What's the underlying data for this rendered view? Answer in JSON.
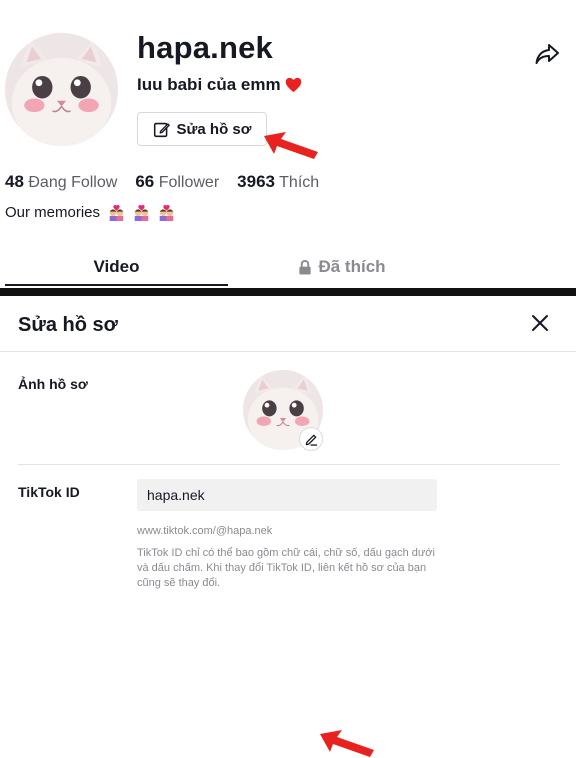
{
  "profile": {
    "username": "hapa.nek",
    "bio": "Iuu babi của emm",
    "bio_emoji": "heart",
    "edit_button_label": "Sửa hồ sơ",
    "stats": [
      {
        "value": "48",
        "label": "Đang Follow"
      },
      {
        "value": "66",
        "label": "Follower"
      },
      {
        "value": "3963",
        "label": "Thích"
      }
    ],
    "memories_text": "Our memories",
    "memories_emoji": [
      "couple-kiss",
      "couple-kiss",
      "couple-kiss"
    ],
    "tabs": [
      {
        "label": "Video",
        "active": true
      },
      {
        "label": "Đã thích",
        "locked": true
      }
    ]
  },
  "edit_panel": {
    "title": "Sửa hồ sơ",
    "photo_label": "Ảnh hồ sơ",
    "id_label": "TikTok ID",
    "id_value": "hapa.nek",
    "id_url": "www.tiktok.com/@hapa.nek",
    "id_help": "TikTok ID chỉ có thể bao gồm chữ cái, chữ số, dấu gạch dưới và dấu chấm. Khi thay đổi TikTok ID, liên kết hồ sơ của bạn cũng sẽ thay đổi."
  },
  "icons": [
    "share-icon",
    "edit-icon",
    "lock-icon",
    "close-icon",
    "pencil-icon",
    "red-arrow"
  ],
  "colors": {
    "text": "#161823",
    "muted": "#8a8b91",
    "arrow_red": "#e8231f",
    "heart": "#e8231f",
    "divider": "#111111"
  }
}
